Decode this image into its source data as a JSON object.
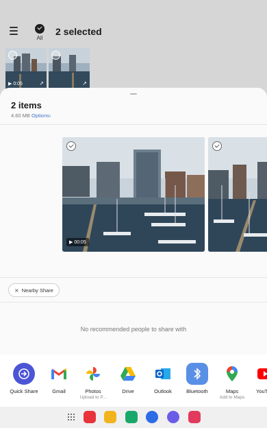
{
  "gallery": {
    "all_label": "All",
    "selected_title": "2 selected",
    "thumbs": [
      {
        "duration": "▶ 0:05"
      },
      {
        "duration": ""
      }
    ]
  },
  "share_sheet": {
    "title": "2 items",
    "size": "4.60 MB",
    "options_label": "Options",
    "options_chevron": "›",
    "preview_duration": "▶ 00:05",
    "nearby_share_label": "Nearby Share",
    "no_people_text": "No recommended people to share with",
    "apps": [
      {
        "label": "Quick Share",
        "sub": "",
        "icon": "quick-share-icon",
        "color": "#4b55d6"
      },
      {
        "label": "Gmail",
        "sub": "",
        "icon": "gmail-icon",
        "color": "#ffffff"
      },
      {
        "label": "Photos",
        "sub": "Upload to P...",
        "icon": "google-photos-icon",
        "color": "#ffffff"
      },
      {
        "label": "Drive",
        "sub": "",
        "icon": "google-drive-icon",
        "color": "#ffffff"
      },
      {
        "label": "Outlook",
        "sub": "",
        "icon": "outlook-icon",
        "color": "#0a64c8"
      },
      {
        "label": "Bluetooth",
        "sub": "",
        "icon": "bluetooth-icon",
        "color": "#5a8fe6"
      },
      {
        "label": "Maps",
        "sub": "Add to Maps",
        "icon": "google-maps-icon",
        "color": "#ffffff"
      },
      {
        "label": "YouT",
        "sub": "",
        "icon": "youtube-icon",
        "color": "#ff0000"
      }
    ]
  },
  "dock": {
    "apps": [
      {
        "icon": "app-drawer-icon"
      },
      {
        "icon": "flipboard-icon",
        "color": "#e8333a"
      },
      {
        "icon": "my-files-icon",
        "color": "#f2b41e"
      },
      {
        "icon": "phone-icon",
        "color": "#1aa86a"
      },
      {
        "icon": "messages-icon",
        "color": "#2e6be6"
      },
      {
        "icon": "internet-icon",
        "color": "#6b5ce7"
      },
      {
        "icon": "camera-icon",
        "color": "#e23a5c"
      }
    ]
  }
}
